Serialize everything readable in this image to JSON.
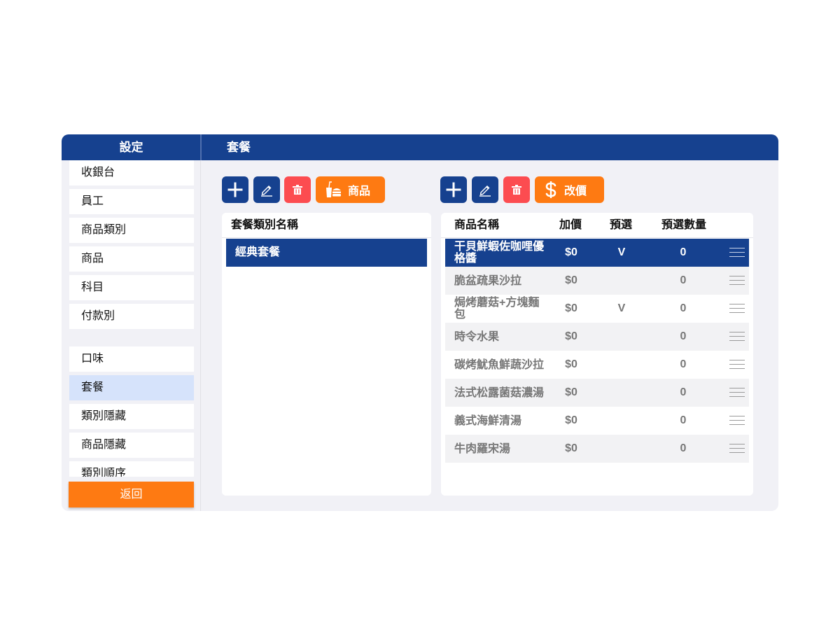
{
  "header": {
    "left_title": "設定",
    "main_title": "套餐"
  },
  "sidebar": {
    "items": [
      {
        "label": "收銀台"
      },
      {
        "label": "員工"
      },
      {
        "label": "商品類別"
      },
      {
        "label": "商品"
      },
      {
        "label": "科目"
      },
      {
        "label": "付款別"
      },
      {
        "label": "口味"
      },
      {
        "label": "套餐",
        "active": true
      },
      {
        "label": "類別隱藏"
      },
      {
        "label": "商品隱藏"
      },
      {
        "label": "類別順序"
      }
    ],
    "back_label": "返回"
  },
  "category_toolbar": {
    "add_icon": "plus-icon",
    "edit_icon": "pencil-icon",
    "delete_icon": "trash-icon",
    "items_label": "商品",
    "items_icon": "food-icon"
  },
  "product_toolbar": {
    "add_icon": "plus-icon",
    "edit_icon": "pencil-icon",
    "delete_icon": "trash-icon",
    "price_label": "改價",
    "price_icon": "dollar-icon"
  },
  "category_panel": {
    "header": "套餐類別名稱",
    "rows": [
      {
        "name": "經典套餐",
        "selected": true
      }
    ]
  },
  "product_panel": {
    "headers": {
      "name": "商品名稱",
      "price": "加價",
      "default": "預選",
      "qty": "預選數量"
    },
    "rows": [
      {
        "name": "干貝鮮蝦佐咖哩優格醬",
        "price": "$0",
        "default": "V",
        "qty": "0",
        "selected": true
      },
      {
        "name": "脆盆疏果沙拉",
        "price": "$0",
        "default": "",
        "qty": "0"
      },
      {
        "name": "焗烤蘑菇+方塊麵包",
        "price": "$0",
        "default": "V",
        "qty": "0"
      },
      {
        "name": "時令水果",
        "price": "$0",
        "default": "",
        "qty": "0"
      },
      {
        "name": "碳烤魷魚鮮蔬沙拉",
        "price": "$0",
        "default": "",
        "qty": "0"
      },
      {
        "name": "法式松露菌菇濃湯",
        "price": "$0",
        "default": "",
        "qty": "0"
      },
      {
        "name": "義式海鮮清湯",
        "price": "$0",
        "default": "",
        "qty": "0"
      },
      {
        "name": "牛肉羅宋湯",
        "price": "$0",
        "default": "",
        "qty": "0"
      }
    ]
  },
  "colors": {
    "primary": "#16418f",
    "danger": "#fc4c50",
    "accent": "#fe7a12",
    "active_item": "#d6e3fb",
    "background": "#f1f1f6"
  }
}
